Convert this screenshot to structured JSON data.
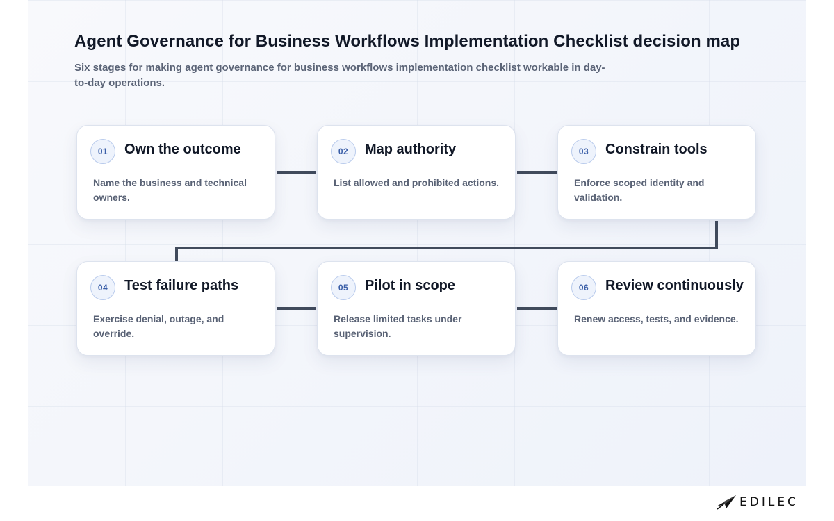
{
  "header": {
    "title": "Agent Governance for Business Workflows Implementation Checklist decision map",
    "subtitle": "Six stages for making agent governance for business workflows implementation checklist workable in day-to-day operations."
  },
  "stages": [
    {
      "number": "01",
      "title": "Own the outcome",
      "description": "Name the business and technical owners."
    },
    {
      "number": "02",
      "title": "Map authority",
      "description": "List allowed and prohibited actions."
    },
    {
      "number": "03",
      "title": "Constrain tools",
      "description": "Enforce scoped identity and validation."
    },
    {
      "number": "04",
      "title": "Test failure paths",
      "description": "Exercise denial, outage, and override."
    },
    {
      "number": "05",
      "title": "Pilot in scope",
      "description": "Release limited tasks under supervision."
    },
    {
      "number": "06",
      "title": "Review continuously",
      "description": "Renew access, tests, and evidence."
    }
  ],
  "colors": {
    "connector": "#414b5c",
    "badge_text": "#3b5fa8",
    "badge_border": "#b9cbec"
  },
  "brand": {
    "logo_text": "EDILEC",
    "logo_icon": "paper-plane-icon"
  }
}
